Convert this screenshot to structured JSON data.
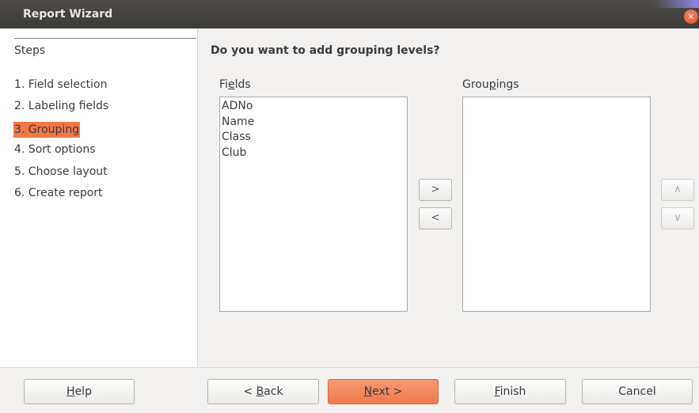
{
  "window": {
    "title": "Report Wizard",
    "close_icon": "×"
  },
  "steps": {
    "heading": "Steps",
    "items": [
      {
        "label": "1. Field selection"
      },
      {
        "label": "2. Labeling fields"
      },
      {
        "label": "3. Grouping",
        "active": true
      },
      {
        "label": "4. Sort options"
      },
      {
        "label": "5. Choose layout"
      },
      {
        "label": "6. Create report"
      }
    ]
  },
  "main": {
    "question": "Do you want to add grouping levels?",
    "fields": {
      "label_pre": "Fi",
      "label_mnemonic": "e",
      "label_post": "lds",
      "items": [
        "ADNo",
        "Name",
        "Class",
        "Club"
      ]
    },
    "groupings": {
      "label_pre": "Grou",
      "label_mnemonic": "p",
      "label_post": "ings",
      "items": []
    },
    "add_button": ">",
    "remove_button": "<",
    "move_up_button": "∧",
    "move_down_button": "∨"
  },
  "footer": {
    "help": {
      "mnemonic": "H",
      "rest": "elp"
    },
    "back": {
      "pre": "< ",
      "mnemonic": "B",
      "rest": "ack"
    },
    "next": {
      "mnemonic": "N",
      "rest": "ext >"
    },
    "finish": {
      "mnemonic": "F",
      "rest": "inish"
    },
    "cancel": "Cancel"
  },
  "colors": {
    "accent": "#f07746",
    "titlebar": "#3d3b37"
  }
}
